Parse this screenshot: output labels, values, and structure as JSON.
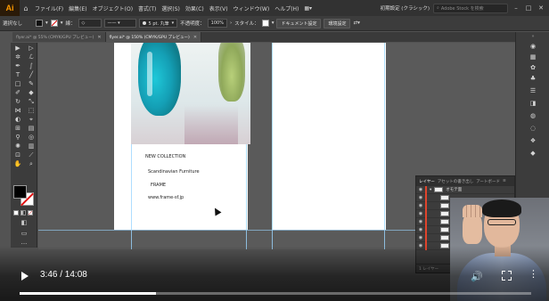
{
  "menubar": {
    "logo": "Ai",
    "items": [
      "ファイル(F)",
      "編集(E)",
      "オブジェクト(O)",
      "書式(T)",
      "選択(S)",
      "効果(C)",
      "表示(V)",
      "ウィンドウ(W)",
      "ヘルプ(H)"
    ],
    "workspace": "初期設定 (クラシック)",
    "stock_placeholder": "Adobe Stock を検索"
  },
  "controlbar": {
    "selection": "選択なし",
    "stroke_label": "線：",
    "brush": "5 pt. 丸筆",
    "opacity_label": "不透明度：",
    "opacity": "100%",
    "style_label": "スタイル：",
    "doc_setup": "ドキュメント設定",
    "prefs": "環境設定"
  },
  "tabs": [
    {
      "label": "flyer.ai* @ 55% (CMYK/GPU プレビュー)"
    },
    {
      "label": "flyer.ai* @ 150% (CMYK/GPU プレビュー)"
    }
  ],
  "artboard": {
    "lines": [
      "NEW COLLECTION",
      "Scandinavian Furniture",
      "FRAME",
      "www.frame-sf.jp"
    ]
  },
  "layers": {
    "tabs": [
      "レイヤー",
      "アセットの書き出し",
      "アートボード"
    ],
    "layer_name": "オモテ面",
    "footer": "1 レイヤー"
  },
  "video": {
    "time": "3:46 / 14:08",
    "progress": 0.267
  }
}
